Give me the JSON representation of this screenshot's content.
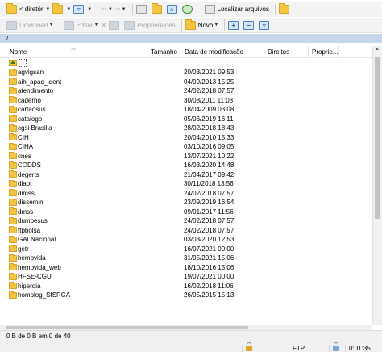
{
  "toolbar1": {
    "dir_dropdown": "< diretóri",
    "find_files_label": "Localizar arquivos"
  },
  "toolbar2": {
    "download_label": "Download",
    "edit_label": "Editar",
    "properties_label": "Propriedades",
    "new_label": "Novo"
  },
  "path": "/",
  "columns": {
    "name": "Nome",
    "size": "Tamanho",
    "modified": "Data de modificação",
    "rights": "Direitos",
    "owner": "Proprie..."
  },
  "parent_dir": "..",
  "files": [
    {
      "name": "agvigsan",
      "date": "20/03/2021 09:53"
    },
    {
      "name": "aih_apac_ident",
      "date": "04/09/2013 15:25"
    },
    {
      "name": "atendimento",
      "date": "24/02/2018 07:57"
    },
    {
      "name": "caderno",
      "date": "30/08/2011 11:03"
    },
    {
      "name": "cartaosus",
      "date": "18/04/2009 03:08"
    },
    {
      "name": "catalogo",
      "date": "05/06/2019 16:11"
    },
    {
      "name": "cgsi Brasilia",
      "date": "28/02/2018 18:43"
    },
    {
      "name": "CIH",
      "date": "20/04/2010 15:33"
    },
    {
      "name": "CIHA",
      "date": "03/10/2016 09:05"
    },
    {
      "name": "cnes",
      "date": "13/07/2021 10:22"
    },
    {
      "name": "CODDS",
      "date": "16/03/2020 14:48"
    },
    {
      "name": "degerts",
      "date": "21/04/2017 09:42"
    },
    {
      "name": "diapt",
      "date": "30/11/2018 13:56"
    },
    {
      "name": "dimss",
      "date": "24/02/2018 07:57"
    },
    {
      "name": "dissemin",
      "date": "23/09/2019 16:54"
    },
    {
      "name": "dmss",
      "date": "09/01/2017 11:56"
    },
    {
      "name": "dumpesus",
      "date": "24/02/2018 07:57"
    },
    {
      "name": "ftpbolsa",
      "date": "24/02/2018 07:57"
    },
    {
      "name": "GALNacional",
      "date": "03/03/2020 12:53"
    },
    {
      "name": "getr",
      "date": "16/07/2021 00:00"
    },
    {
      "name": "hemovida",
      "date": "31/05/2021 15:06"
    },
    {
      "name": "hemovida_web",
      "date": "18/10/2016 15:06"
    },
    {
      "name": "HFSE-CGU",
      "date": "19/07/2021 00:00"
    },
    {
      "name": "hiperdia",
      "date": "16/02/2018 11:06"
    },
    {
      "name": "homolog_SISRCA",
      "date": "26/05/2015 15:13"
    }
  ],
  "status": {
    "selection": "0 B de 0 B em 0 de 40",
    "protocol": "FTP",
    "elapsed": "0:01:35"
  }
}
